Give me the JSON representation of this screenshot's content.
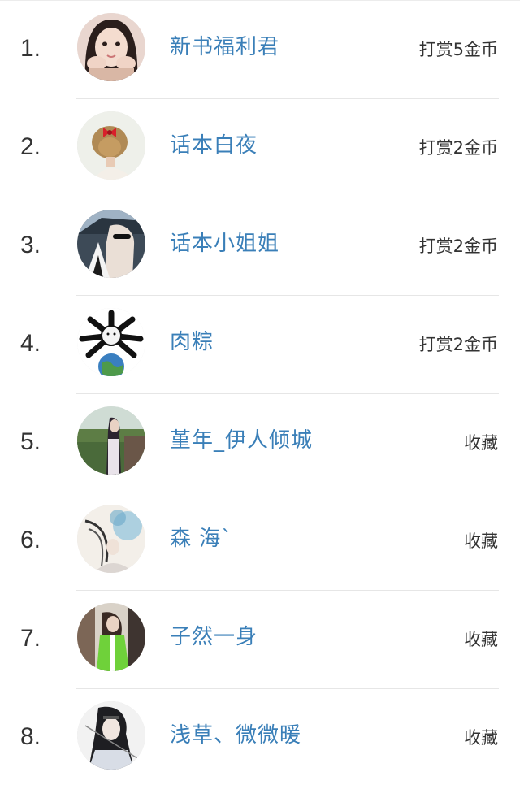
{
  "rows": [
    {
      "rank": "1.",
      "name": "新书福利君",
      "action": "打赏5金币",
      "avatar": "girl-hands-avatar"
    },
    {
      "rank": "2.",
      "name": "话本白夜",
      "action": "打赏2金币",
      "avatar": "hair-bow-avatar"
    },
    {
      "rank": "3.",
      "name": "话本小姐姐",
      "action": "打赏2金币",
      "avatar": "sunglasses-car-avatar"
    },
    {
      "rank": "4.",
      "name": "肉粽",
      "action": "打赏2金币",
      "avatar": "cartoon-earth-avatar"
    },
    {
      "rank": "5.",
      "name": "堇年_伊人倾城",
      "action": "收藏",
      "avatar": "girl-field-avatar"
    },
    {
      "rank": "6.",
      "name": "森 海ˋ",
      "action": "收藏",
      "avatar": "ink-painting-avatar"
    },
    {
      "rank": "7.",
      "name": "子然一身",
      "action": "收藏",
      "avatar": "green-coat-avatar"
    },
    {
      "rank": "8.",
      "name": "浅草、微微暖",
      "action": "收藏",
      "avatar": "anime-swordsman-avatar"
    }
  ]
}
